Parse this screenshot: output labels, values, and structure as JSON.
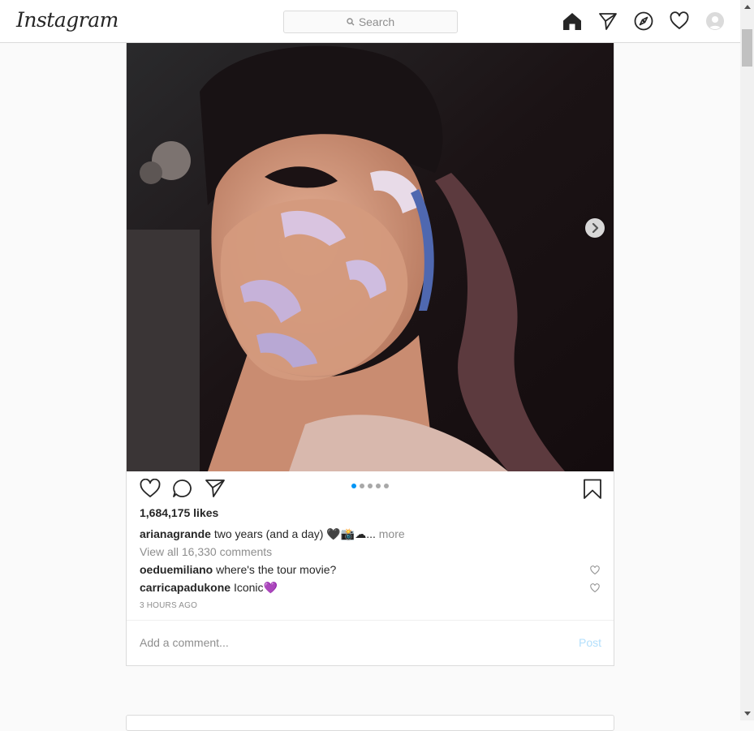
{
  "nav": {
    "logo": "Instagram",
    "search_placeholder": "Search",
    "icons": [
      "home-icon",
      "direct-icon",
      "explore-icon",
      "activity-icon",
      "profile-avatar"
    ]
  },
  "post": {
    "likes": "1,684,175 likes",
    "caption": {
      "username": "arianagrande",
      "text": "two years (and a day) 🖤📸☁",
      "ellipsis": "...",
      "more": "more"
    },
    "view_all": "View all 16,330 comments",
    "comments": [
      {
        "username": "oeduemiliano",
        "text": "where's the tour movie?"
      },
      {
        "username": "carricapadukone",
        "text": "Iconic💜"
      }
    ],
    "timestamp": "3 HOURS AGO",
    "carousel": {
      "count": 5,
      "active_index": 0
    },
    "add_comment_placeholder": "Add a comment...",
    "post_button": "Post"
  },
  "colors": {
    "accent": "#0095f6",
    "post_disabled": "#b2dffc",
    "border": "#dbdbdb",
    "background": "#fafafa"
  }
}
